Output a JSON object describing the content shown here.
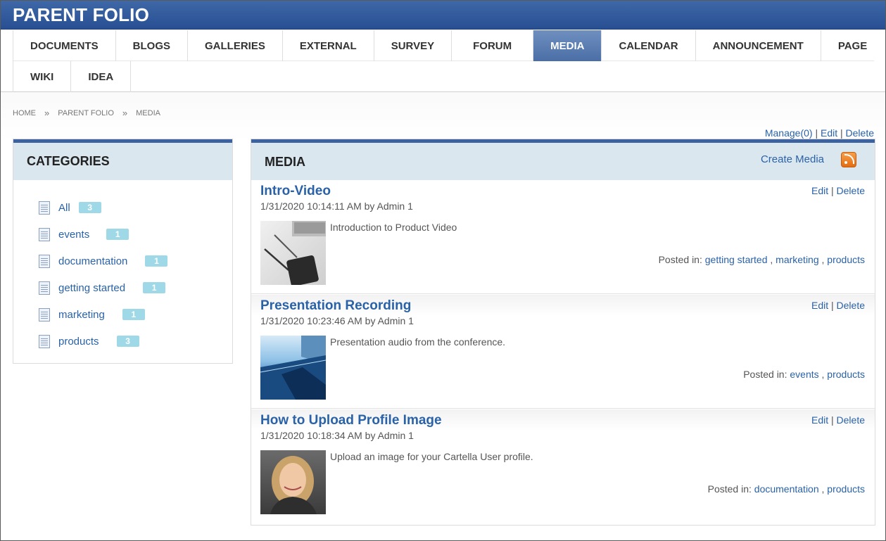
{
  "header": {
    "title": "PARENT FOLIO"
  },
  "nav": {
    "row1": [
      "DOCUMENTS",
      "BLOGS",
      "GALLERIES",
      "EXTERNAL",
      "SURVEY",
      "FORUM",
      "MEDIA",
      "CALENDAR",
      "ANNOUNCEMENT",
      "PAGE"
    ],
    "row2": [
      "WIKI",
      "IDEA"
    ],
    "active": "MEDIA"
  },
  "breadcrumb": {
    "home": "HOME",
    "parent": "PARENT FOLIO",
    "current": "MEDIA",
    "sep": "»"
  },
  "top_actions": {
    "manage": "Manage(0)",
    "edit": "Edit",
    "delete": "Delete",
    "sep": "|"
  },
  "categories": {
    "title": "CATEGORIES",
    "items": [
      {
        "label": "All",
        "count": "3"
      },
      {
        "label": "events",
        "count": "1"
      },
      {
        "label": "documentation",
        "count": "1"
      },
      {
        "label": "getting started",
        "count": "1"
      },
      {
        "label": "marketing",
        "count": "1"
      },
      {
        "label": "products",
        "count": "3"
      }
    ]
  },
  "media": {
    "title": "MEDIA",
    "create": "Create Media",
    "rss_icon": "rss-icon",
    "items": [
      {
        "title": "Intro-Video",
        "meta": "1/31/2020 10:14:11 AM by Admin 1",
        "description": "Introduction to Product Video",
        "edit": "Edit",
        "delete": "Delete",
        "posted_label": "Posted in:",
        "tags": [
          "getting started",
          "marketing",
          "products"
        ]
      },
      {
        "title": "Presentation Recording",
        "meta": "1/31/2020 10:23:46 AM by Admin 1",
        "description": "Presentation audio from the conference.",
        "edit": "Edit",
        "delete": "Delete",
        "posted_label": "Posted in:",
        "tags": [
          "events",
          "products"
        ]
      },
      {
        "title": "How to Upload Profile Image",
        "meta": "1/31/2020 10:18:34 AM by Admin 1",
        "description": "Upload an image for your Cartella User profile.",
        "edit": "Edit",
        "delete": "Delete",
        "posted_label": "Posted in:",
        "tags": [
          "documentation",
          "products"
        ]
      }
    ]
  },
  "colors": {
    "header": "#2c5597",
    "link": "#2a62a8",
    "badge": "#9fd9e8",
    "panel_head": "#dbe7ef"
  }
}
